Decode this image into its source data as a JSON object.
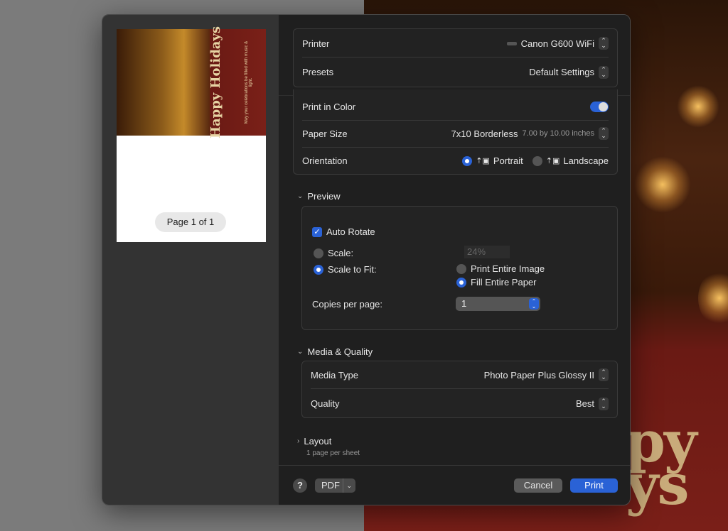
{
  "background": {
    "text_1": "py",
    "text_2": "ys"
  },
  "preview": {
    "card_title": "Happy Holidays",
    "card_subtitle": "May your celebrations be filled with music & light.",
    "page_indicator": "Page 1 of 1"
  },
  "printer": {
    "label": "Printer",
    "value": "Canon G600 WiFi",
    "icon": "printer-icon"
  },
  "presets": {
    "label": "Presets",
    "value": "Default Settings"
  },
  "color": {
    "label": "Print in Color",
    "enabled": true
  },
  "paper_size": {
    "label": "Paper Size",
    "value": "7x10 Borderless",
    "detail": "7.00 by 10.00 inches"
  },
  "orientation": {
    "label": "Orientation",
    "options": [
      "Portrait",
      "Landscape"
    ],
    "selected": "Portrait"
  },
  "preview_section": {
    "title": "Preview",
    "auto_rotate": {
      "label": "Auto Rotate",
      "checked": true
    },
    "scale": {
      "label": "Scale:",
      "value": "24%",
      "selected": false
    },
    "scale_to_fit": {
      "label": "Scale to Fit:",
      "selected": true
    },
    "fit_options": [
      "Print Entire Image",
      "Fill Entire Paper"
    ],
    "fit_selected": "Fill Entire Paper",
    "copies_label": "Copies per page:",
    "copies_value": "1"
  },
  "media": {
    "title": "Media & Quality",
    "media_type_label": "Media Type",
    "media_type_value": "Photo Paper Plus Glossy II",
    "quality_label": "Quality",
    "quality_value": "Best"
  },
  "layout": {
    "title": "Layout",
    "summary": "1 page per sheet"
  },
  "footer": {
    "help": "?",
    "pdf": "PDF",
    "cancel": "Cancel",
    "print": "Print"
  },
  "colors": {
    "accent": "#2a62d6",
    "panel": "#1f1f1f",
    "sidebar": "#333333"
  }
}
